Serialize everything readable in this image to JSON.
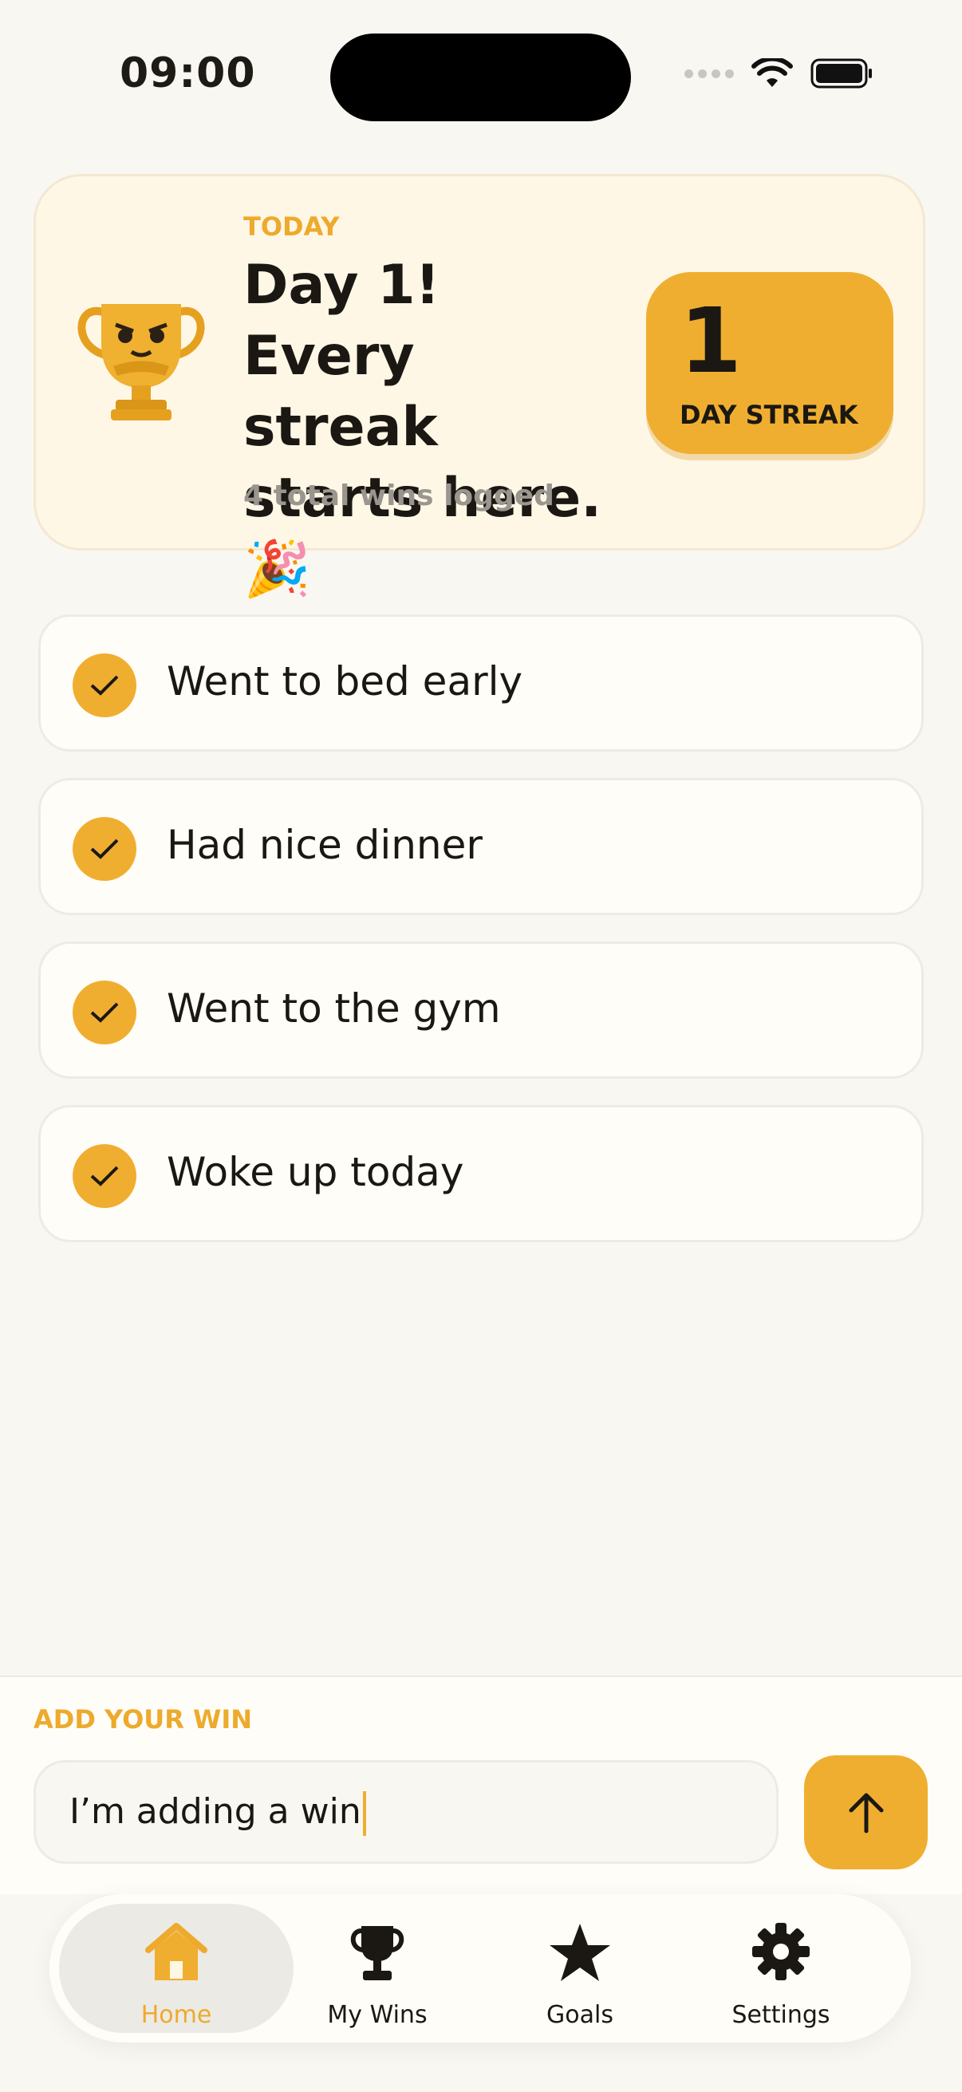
{
  "status": {
    "time": "09:00"
  },
  "hero": {
    "label": "TODAY",
    "title": "Day 1! Every streak starts here. 🎉",
    "subtitle": "4 total wins logged",
    "streak_value": "1",
    "streak_label": "DAY STREAK"
  },
  "wins": [
    {
      "text": "Went to bed early"
    },
    {
      "text": "Had nice dinner"
    },
    {
      "text": "Went to the gym"
    },
    {
      "text": "Woke up today"
    }
  ],
  "add": {
    "label": "ADD YOUR WIN",
    "input_value": "I’m adding a win"
  },
  "tabs": [
    {
      "label": "Home",
      "icon": "home-icon",
      "active": true
    },
    {
      "label": "My Wins",
      "icon": "trophy-icon"
    },
    {
      "label": "Goals",
      "icon": "star-icon"
    },
    {
      "label": "Settings",
      "icon": "gear-icon"
    }
  ],
  "colors": {
    "accent": "#F0AE30",
    "background": "#F9F7F2",
    "card": "#FFF7E6"
  }
}
